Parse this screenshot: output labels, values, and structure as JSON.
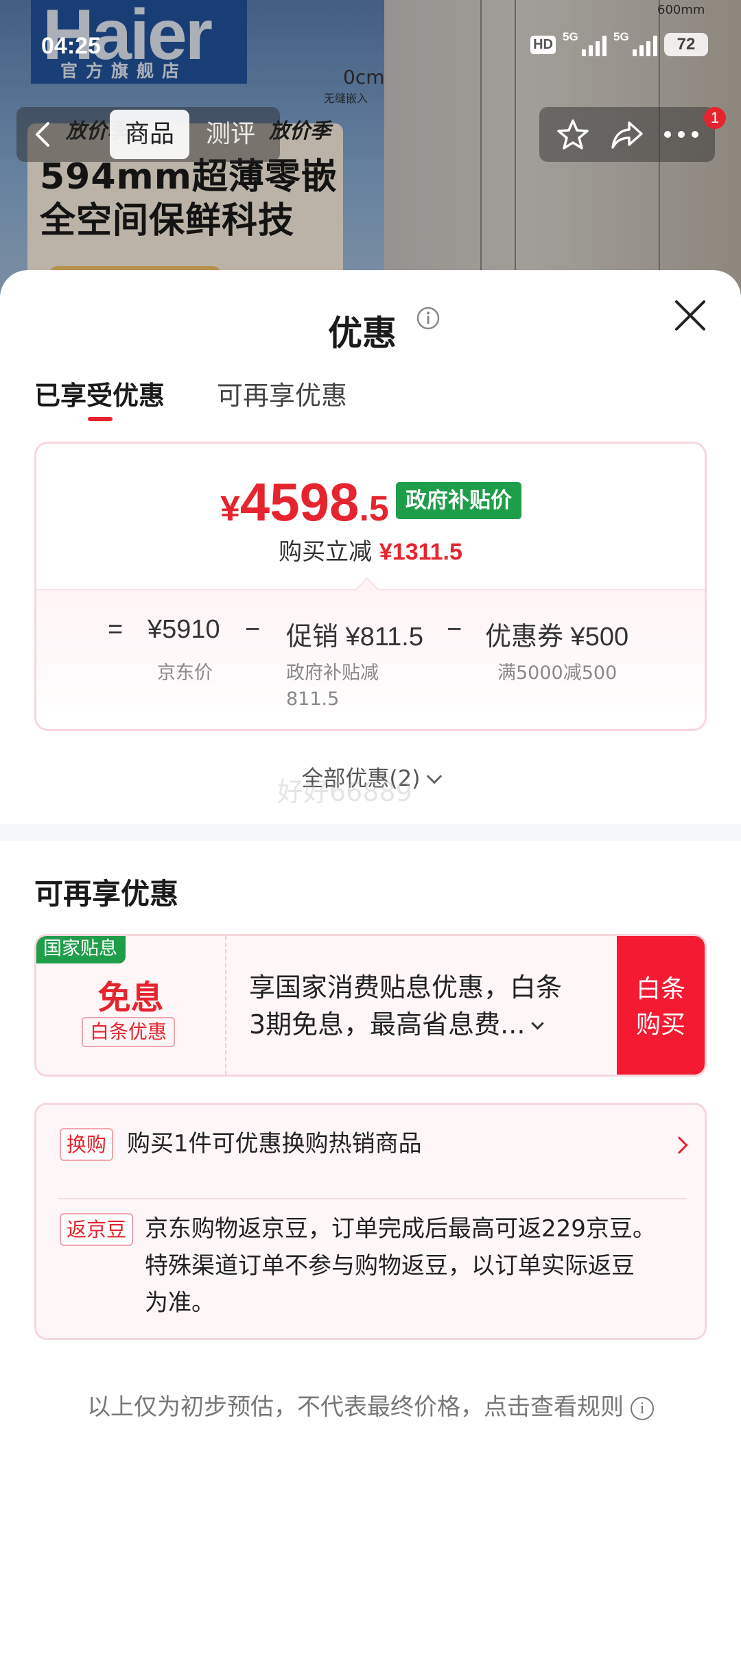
{
  "status_bar": {
    "time": "04:25",
    "hd_label": "HD",
    "sim1_label": "5G",
    "sim2_label": "5G",
    "battery": "72"
  },
  "banner": {
    "brand": "Haier",
    "brand_sub": "官方旗舰店",
    "dim_label": "0cm",
    "dim_sub": "无缝嵌入",
    "dim_top": "600mm",
    "promo_left": "放价季",
    "promo_right": "放价季",
    "slogan_line1": "594mm超薄零嵌",
    "slogan_line2": "全空间保鲜科技"
  },
  "nav": {
    "tab_goods": "商品",
    "tab_review": "测评",
    "cart_badge": "1"
  },
  "sheet": {
    "title": "优惠",
    "tabs": [
      {
        "label": "已享受优惠",
        "active": true
      },
      {
        "label": "可再享优惠",
        "active": false
      }
    ]
  },
  "price_summary": {
    "currency": "¥",
    "final_int": "4598",
    "final_dec": ".5",
    "gov_tag": "政府补贴价",
    "instant_label": "购买立减",
    "instant_value": "¥1311.5",
    "equals": "=",
    "jd_price": "¥5910",
    "jd_label": "京东价",
    "minus1": "−",
    "promo_value": "促销 ¥811.5",
    "promo_label_1": "政府补贴减",
    "promo_label_2": "811.5",
    "minus2": "−",
    "coupon_value": "优惠券 ¥500",
    "coupon_label": "满5000减500"
  },
  "all_discounts": "全部优惠(2)",
  "watermark": "好好66889",
  "more_offers": {
    "title": "可再享优惠",
    "interest": {
      "tag": "国家贴息",
      "headline": "免息",
      "sub": "白条优惠",
      "desc_line1": "享国家消费贴息优惠，白条",
      "desc_line2": "3期免息，最高省息费...",
      "buy_line1": "白条",
      "buy_line2": "购买"
    },
    "exchange": {
      "pill": "换购",
      "text": "购买1件可优惠换购热销商品"
    },
    "beans": {
      "pill": "返京豆",
      "line1": "京东购物返京豆，订单完成后最高可返229京豆。",
      "line2": "特殊渠道订单不参与购物返豆，以订单实际返豆",
      "line3": "为准。"
    }
  },
  "footer_note": "以上仅为初步预估，不代表最终价格，点击查看规则",
  "colors": {
    "accent_red": "#e6242e",
    "gov_green": "#1f9e4a",
    "buy_red": "#f41a32"
  }
}
